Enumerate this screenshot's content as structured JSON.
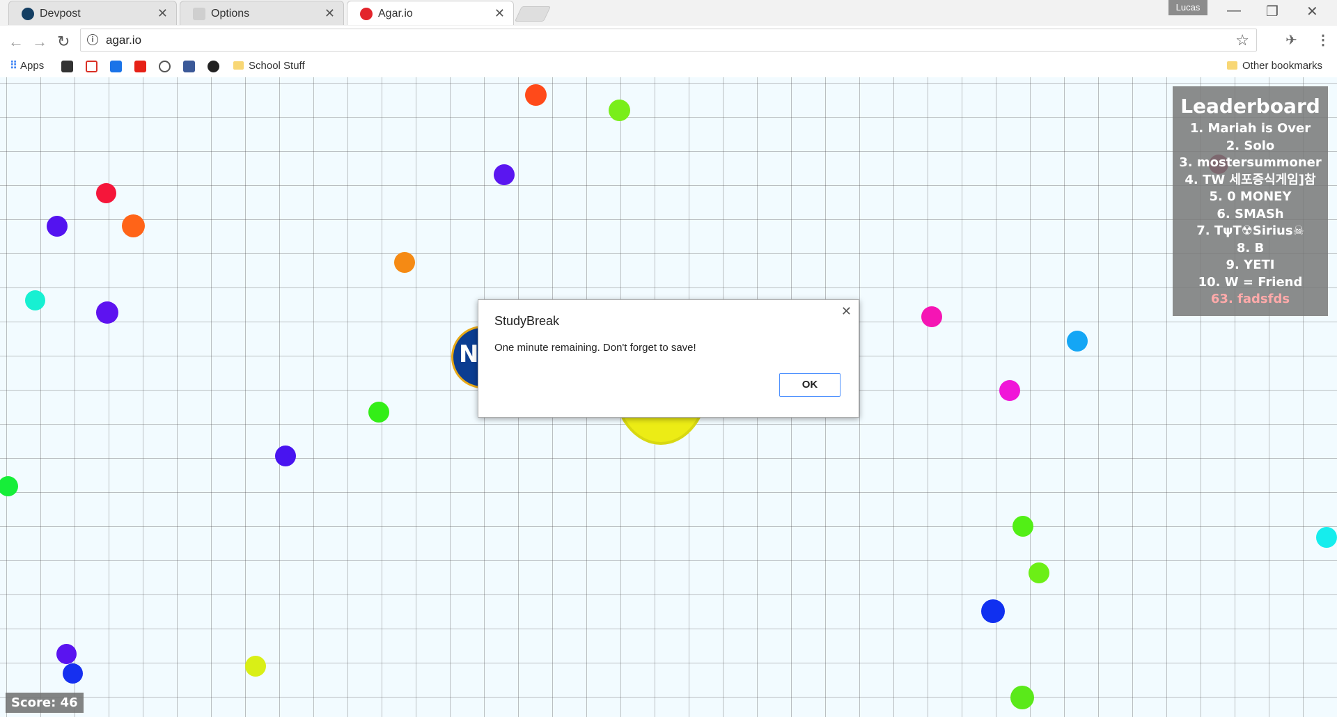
{
  "browser": {
    "tabs": [
      {
        "title": "Devpost",
        "favicon": "devpost-icon"
      },
      {
        "title": "Options",
        "favicon": "studybreak-icon"
      },
      {
        "title": "Agar.io",
        "favicon": "agario-icon"
      }
    ],
    "profile_name": "Lucas",
    "url": "agar.io"
  },
  "bookmarks": {
    "apps_label": "Apps",
    "school_folder": "School Stuff",
    "other": "Other bookmarks",
    "icons": [
      "blackboard-icon",
      "gmail-icon",
      "mail-icon",
      "youtube-icon",
      "reddit-icon",
      "facebook-icon",
      "github-icon"
    ]
  },
  "leaderboard": {
    "title": "Leaderboard",
    "entries": [
      "1. Mariah is Over",
      "2. Solo",
      "3. mostersummoner",
      "4. TW   세포증식게임]참",
      "5. 0 MONEY",
      "6. SMASh",
      "7. TψT☢Sirius☠",
      "8. B",
      "9. YETI",
      "10. W = Friend"
    ],
    "player_rank": "63. fadsfds"
  },
  "score": "Score: 46",
  "dialog": {
    "title": "StudyBreak",
    "message": "One minute remaining.  Don't forget to save!",
    "ok_label": "OK"
  },
  "colors": {
    "game_background": "#f2fbff",
    "player_cell": "#eaea1a",
    "dialog_button_border": "#4d90fe"
  }
}
